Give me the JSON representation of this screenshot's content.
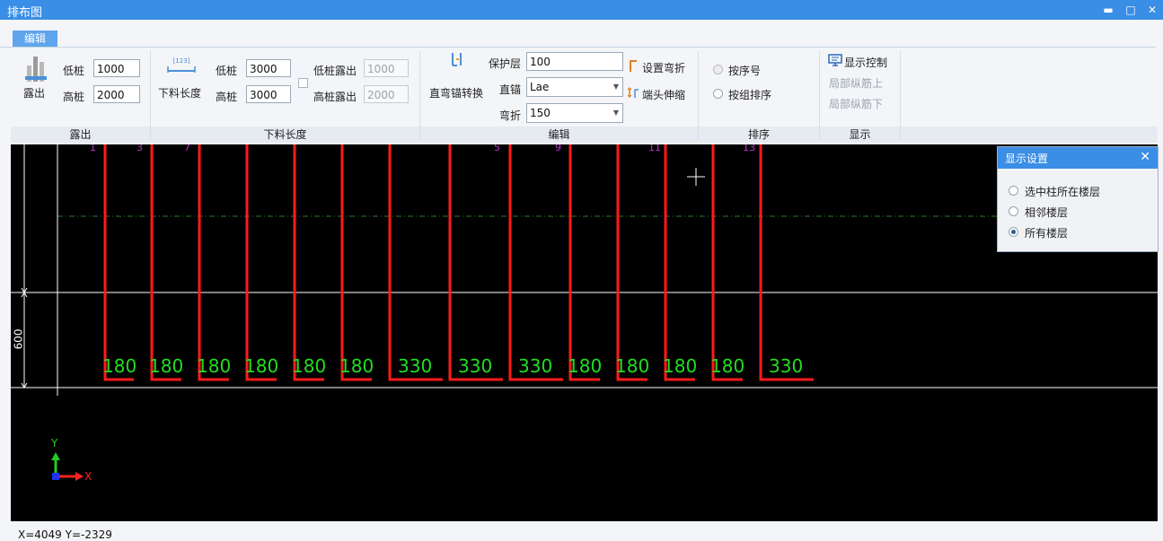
{
  "window": {
    "title": "排布图",
    "minimize": "▬",
    "maximize": "□",
    "close": "✕"
  },
  "tab": {
    "label": "编辑"
  },
  "ribbon": {
    "groups": [
      "露出",
      "下料长度",
      "编辑",
      "排序",
      "显示"
    ],
    "expose": {
      "button": "露出",
      "low_label": "低桩",
      "low_value": "1000",
      "high_label": "高桩",
      "high_value": "2000"
    },
    "cut_length": {
      "button": "下料长度",
      "icon_text": "[123]",
      "low_label": "低桩",
      "low_value": "3000",
      "high_label": "高桩",
      "high_value": "3000",
      "low_expose_label": "低桩露出",
      "low_expose_value": "1000",
      "high_expose_label": "高桩露出",
      "high_expose_value": "2000"
    },
    "edit": {
      "convert_button": "直弯锚转换",
      "cover_label": "保护层",
      "cover_value": "100",
      "straight_label": "直锚",
      "straight_value": "Lae",
      "bend_label": "弯折",
      "bend_value": "150",
      "set_bend": "设置弯折",
      "end_stretch": "端头伸缩"
    },
    "sort": {
      "by_seq": "按序号",
      "by_group": "按组排序"
    },
    "display": {
      "control": "显示控制",
      "local_up": "局部纵筋上",
      "local_down": "局部纵筋下"
    }
  },
  "canvas": {
    "bar_values": [
      "180",
      "180",
      "180",
      "180",
      "180",
      "180",
      "330",
      "330",
      "330",
      "180",
      "180",
      "180",
      "180",
      "330"
    ],
    "top_ticks": [
      "1",
      "3",
      "7",
      "5",
      "9",
      "11",
      "13"
    ],
    "dimension": "600",
    "axis_y": "Y",
    "axis_x": "X"
  },
  "panel": {
    "title": "显示设置",
    "close": "✕",
    "options": [
      "选中柱所在楼层",
      "相邻楼层",
      "所有楼层"
    ],
    "selected": 2
  },
  "status": {
    "coords": "X=4049 Y=-2329"
  },
  "colors": {
    "accent": "#3a8ee6",
    "bar": "#ff1a1a",
    "value": "#22dd22",
    "tick": "#c030d0"
  }
}
